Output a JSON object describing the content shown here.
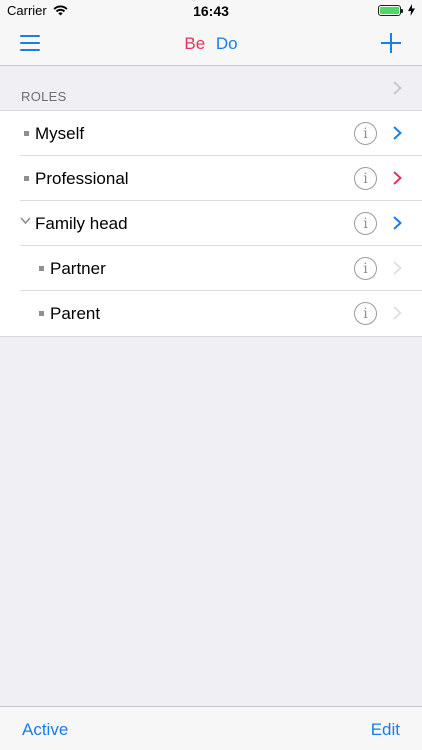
{
  "status_bar": {
    "carrier": "Carrier",
    "time": "16:43",
    "battery_level": 1.0
  },
  "nav": {
    "title_be": "Be",
    "title_do": "Do",
    "colors": {
      "be": "#e8315a",
      "do": "#1a7ee6"
    },
    "left_icon": "hamburger-menu-icon",
    "right_icon": "plus-icon"
  },
  "section": {
    "title": "ROLES"
  },
  "rows": [
    {
      "label": "Myself",
      "chevron_color": "#1a7ee6"
    },
    {
      "label": "Professional",
      "chevron_color": "#e8315a"
    },
    {
      "label": "Family head",
      "chevron_color": "#1a7ee6",
      "expanded": true
    },
    {
      "label": "Partner",
      "chevron_color": "#d8d8dc",
      "child": true
    },
    {
      "label": "Parent",
      "chevron_color": "#d8d8dc",
      "child": true
    }
  ],
  "toolbar": {
    "left_label": "Active",
    "right_label": "Edit"
  }
}
